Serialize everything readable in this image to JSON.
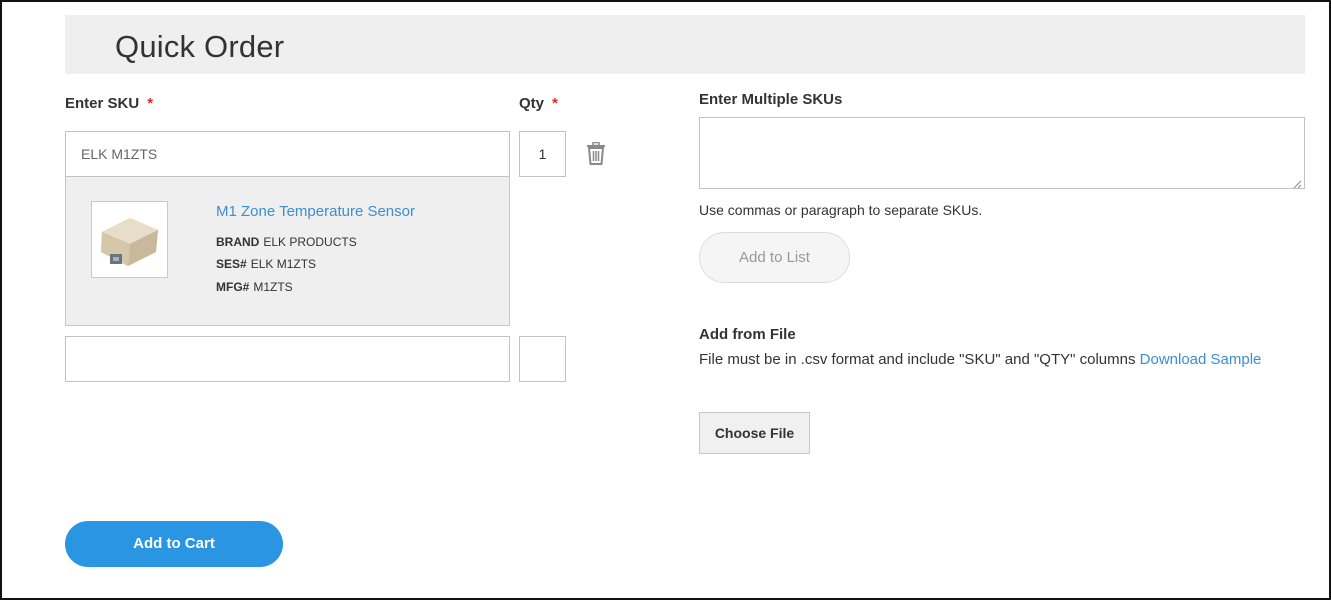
{
  "page": {
    "title": "Quick Order"
  },
  "form": {
    "sku_label": "Enter SKU",
    "qty_label": "Qty",
    "required_mark": "*",
    "rows": [
      {
        "sku_value": "ELK M1ZTS",
        "qty_value": "1"
      },
      {
        "sku_value": "",
        "qty_value": ""
      }
    ],
    "icons": {
      "delete": "trash-icon"
    }
  },
  "suggestion": {
    "product_name": "M1 Zone Temperature Sensor",
    "brand_label": "BRAND",
    "brand_value": "ELK PRODUCTS",
    "ses_label": "SES#",
    "ses_value": "ELK M1ZTS",
    "mfg_label": "MFG#",
    "mfg_value": "M1ZTS"
  },
  "multiple": {
    "label": "Enter Multiple SKUs",
    "value": "",
    "hint": "Use commas or paragraph to separate SKUs.",
    "add_button": "Add to List"
  },
  "file": {
    "label": "Add from File",
    "description": "File must be in .csv format and include \"SKU\" and \"QTY\" columns",
    "download_link": "Download Sample",
    "choose_button": "Choose File"
  },
  "cart": {
    "button": "Add to Cart"
  },
  "colors": {
    "accent": "#2a95e3",
    "link": "#3a8ed8",
    "required": "#e02b27",
    "header_bg": "#efefef"
  }
}
